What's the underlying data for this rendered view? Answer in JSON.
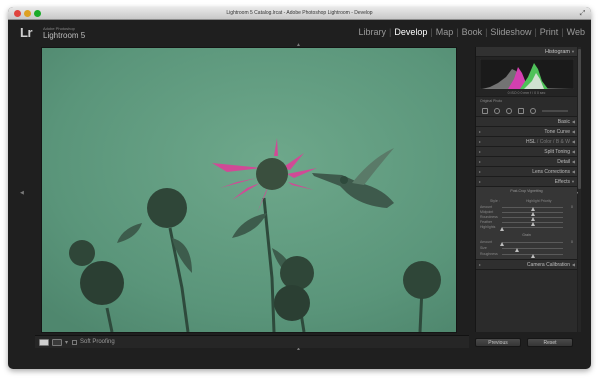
{
  "window": {
    "title": "Lightroom 5 Catalog.lrcat - Adobe Photoshop Lightroom - Develop"
  },
  "identity_plate": {
    "logo": "Lr",
    "vendor": "Adobe Photoshop",
    "app": "Lightroom 5"
  },
  "modules": {
    "items": [
      "Library",
      "Develop",
      "Map",
      "Book",
      "Slideshow",
      "Print",
      "Web"
    ],
    "active": "Develop",
    "separator": "|"
  },
  "toolbar": {
    "view_dropdown": "▾",
    "soft_proofing_label": "Soft Proofing"
  },
  "right_panel": {
    "histogram_label": "Histogram",
    "histogram_readout": "0  ISO 0   0 mm   f / 0   0 sec",
    "original_photo_label": "Original Photo",
    "sections": {
      "basic": "Basic",
      "tone_curve": "Tone Curve",
      "hsl": "HSL",
      "hsl_sep1": " / ",
      "color": "Color",
      "bw": "B & W",
      "split_toning": "Split Toning",
      "detail": "Detail",
      "lens_corrections": "Lens Corrections",
      "effects": "Effects",
      "camera_calibration": "Camera Calibration"
    },
    "effects": {
      "vignetting_title": "Post-Crop Vignetting",
      "style_label": "Style :",
      "style_value": "Highlight Priority",
      "vignette_rows": [
        {
          "label": "Amount",
          "value": "0",
          "position": 0.5
        },
        {
          "label": "Midpoint",
          "value": "",
          "position": 0.5
        },
        {
          "label": "Roundness",
          "value": "",
          "position": 0.5
        },
        {
          "label": "Feather",
          "value": "",
          "position": 0.5
        },
        {
          "label": "Highlights",
          "value": "",
          "position": 0.0
        }
      ],
      "grain_title": "Grain",
      "grain_rows": [
        {
          "label": "Amount",
          "value": "0",
          "position": 0.0
        },
        {
          "label": "Size",
          "value": "",
          "position": 0.25
        },
        {
          "label": "Roughness",
          "value": "",
          "position": 0.5
        }
      ]
    },
    "buttons": {
      "previous": "Previous",
      "reset": "Reset"
    }
  },
  "colors": {
    "photo_background": "#5e9a7c",
    "flower_magenta": "#d04a96",
    "accent_active_module": "#ffffff"
  },
  "icons": {
    "close": "red-traffic-light",
    "minimize": "yellow-traffic-light",
    "zoom": "green-traffic-light",
    "fullscreen": "fullscreen-arrows",
    "panel_arrow": "triangle"
  }
}
